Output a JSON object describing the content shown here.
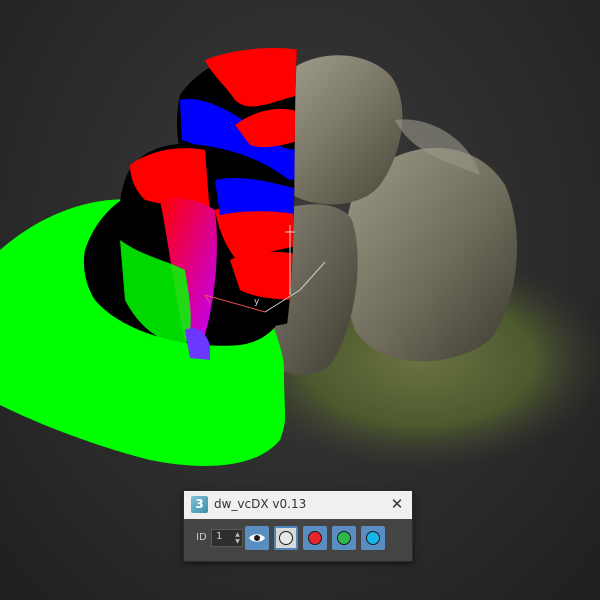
{
  "panel": {
    "title": "dw_vcDX v0.13",
    "app_icon": "3",
    "close_glyph": "✕",
    "id_label": "ID",
    "id_value": "1",
    "buttons": [
      {
        "name": "show-vertex-colors",
        "icon": "eye-icon"
      },
      {
        "name": "channel-all",
        "icon": "white-dot-icon",
        "color": "#e8e8e8",
        "active": true
      },
      {
        "name": "channel-red",
        "icon": "red-dot-icon",
        "color": "#e8262b"
      },
      {
        "name": "channel-green",
        "icon": "green-dot-icon",
        "color": "#2fb84a"
      },
      {
        "name": "channel-blue",
        "icon": "blue-dot-icon",
        "color": "#19b5e8"
      }
    ]
  },
  "viewport": {
    "gizmo_axis_label": "y",
    "colors": {
      "background": "#2e2e2e",
      "vc_red": "#ff0000",
      "vc_green": "#00ff00",
      "vc_blue": "#0000ff",
      "vc_black": "#000000",
      "vc_magenta": "#a020f0",
      "rock": "#7d7a6c",
      "moss": "#5c6a3a"
    }
  }
}
